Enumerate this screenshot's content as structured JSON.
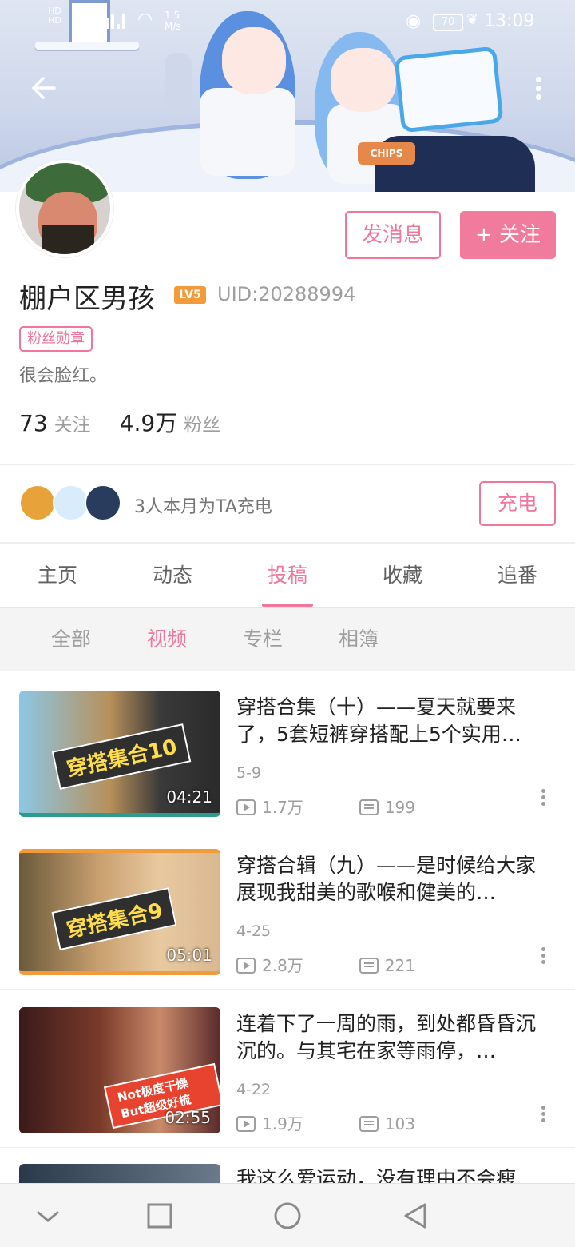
{
  "status_bar": {
    "network": "HD\nHD",
    "speed": "1.5\nM/s",
    "battery": "70",
    "time": "13:09"
  },
  "banner": {
    "chips_label": "CHIPS"
  },
  "profile": {
    "message_button": "发消息",
    "follow_button": "+ 关注",
    "username": "棚户区男孩",
    "level_badge": "LV5",
    "uid": "UID:20288994",
    "medal": "粉丝勋章",
    "signature": "很会脸红。",
    "following_count": "73",
    "following_label": "关注",
    "fans_count": "4.9万",
    "fans_label": "粉丝"
  },
  "charge": {
    "text": "3人本月为TA充电",
    "button": "充电"
  },
  "tabs": [
    "主页",
    "动态",
    "投稿",
    "收藏",
    "追番"
  ],
  "active_tab": "投稿",
  "subtabs": [
    "全部",
    "视频",
    "专栏",
    "相簿"
  ],
  "active_subtab": "视频",
  "videos": [
    {
      "title": "穿搭合集（十）——夏天就要来了，5套短裤穿搭配上5个实用…",
      "date": "5-9",
      "views": "1.7万",
      "comments": "199",
      "duration": "04:21",
      "thumb_text": "穿搭集合10"
    },
    {
      "title": "穿搭合辑（九）——是时候给大家展现我甜美的歌喉和健美的…",
      "date": "4-25",
      "views": "2.8万",
      "comments": "221",
      "duration": "05:01",
      "thumb_text": "穿搭集合9"
    },
    {
      "title": "连着下了一周的雨，到处都昏昏沉沉的。与其宅在家等雨停，…",
      "date": "4-22",
      "views": "1.9万",
      "comments": "103",
      "duration": "02:55",
      "thumb_text": "Not极度干燥 But超级好梳"
    },
    {
      "title": "我这么爱运动，没有理由不会瘦",
      "date": "",
      "views": "",
      "comments": "",
      "duration": "",
      "thumb_text": ""
    }
  ],
  "colors": {
    "accent": "#f0779a",
    "follow_bg": "#f07b9d",
    "text_secondary": "#9e9e9e"
  }
}
